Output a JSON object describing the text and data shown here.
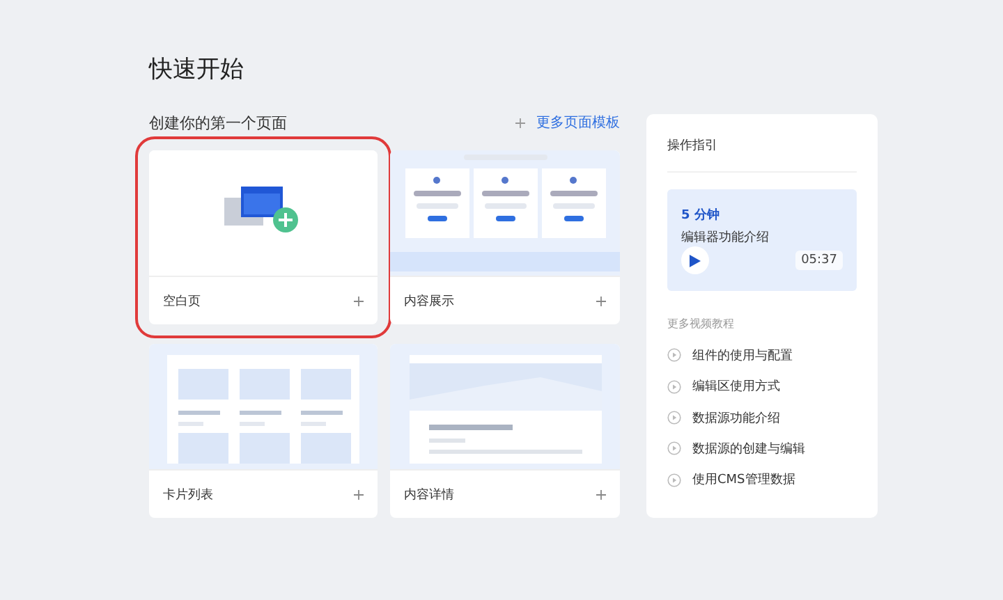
{
  "title": "快速开始",
  "section": {
    "label": "创建你的第一个页面",
    "more_link": "更多页面模板"
  },
  "templates": [
    {
      "kind": "blank",
      "label": "空白页",
      "selected": true
    },
    {
      "kind": "showcase",
      "label": "内容展示",
      "selected": false
    },
    {
      "kind": "cards",
      "label": "卡片列表",
      "selected": false
    },
    {
      "kind": "detail",
      "label": "内容详情",
      "selected": false
    }
  ],
  "guide": {
    "title": "操作指引",
    "video": {
      "duration_label": "5 分钟",
      "name": "编辑器功能介绍",
      "time": "05:37"
    },
    "more_label": "更多视频教程",
    "tutorials": [
      "组件的使用与配置",
      "编辑区使用方式",
      "数据源功能介绍",
      "数据源的创建与编辑",
      "使用CMS管理数据"
    ]
  }
}
